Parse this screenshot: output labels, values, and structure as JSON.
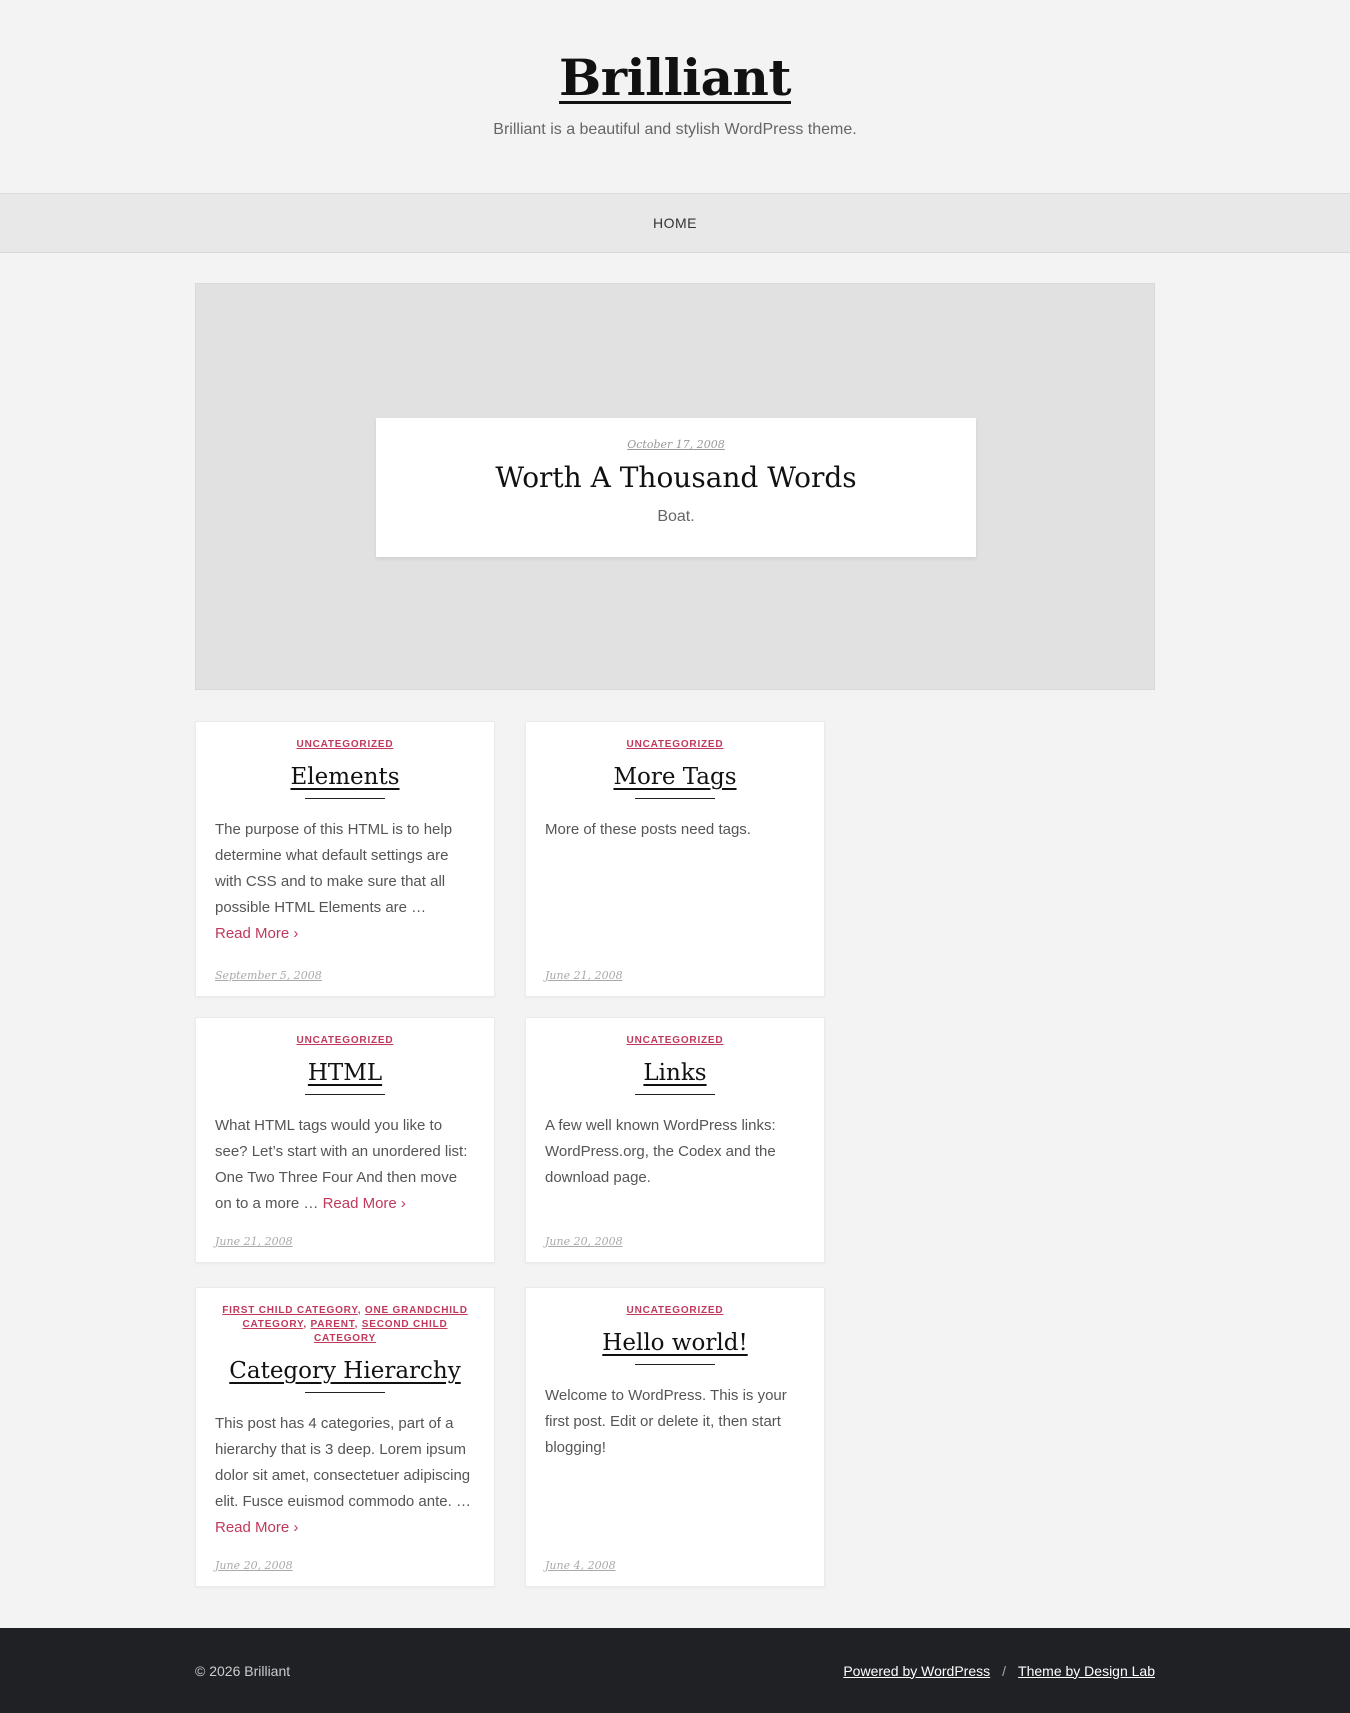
{
  "site": {
    "title": "Brilliant",
    "tagline": "Brilliant is a beautiful and stylish WordPress theme."
  },
  "nav": {
    "items": [
      {
        "label": "HOME"
      }
    ]
  },
  "featured": {
    "date": "October 17, 2008",
    "title": "Worth A Thousand Words",
    "excerpt": "Boat."
  },
  "posts": [
    {
      "categories": [
        "UNCATEGORIZED"
      ],
      "title": "Elements",
      "excerpt": "The purpose of this HTML is to help determine what default settings are with CSS and to make sure that all possible HTML Elements are …",
      "read_more": "Read More ›",
      "date": "September 5, 2008"
    },
    {
      "categories": [
        "UNCATEGORIZED"
      ],
      "title": "More Tags",
      "excerpt": "More of these posts need tags.",
      "read_more": "",
      "date": "June 21, 2008"
    },
    {
      "categories": [
        "UNCATEGORIZED"
      ],
      "title": "HTML",
      "excerpt": "What HTML tags would you like to see? Let’s start with an unordered list: One Two Three Four And then move on to a more …",
      "read_more": "Read More ›",
      "date": "June 21, 2008"
    },
    {
      "categories": [
        "UNCATEGORIZED"
      ],
      "title": "Links",
      "excerpt": "A few well known WordPress links: WordPress.org, the Codex and the download page.",
      "read_more": "",
      "date": "June 20, 2008"
    },
    {
      "categories": [
        "FIRST CHILD CATEGORY",
        "ONE GRANDCHILD CATEGORY",
        "PARENT",
        "SECOND CHILD CATEGORY"
      ],
      "title": "Category Hierarchy",
      "excerpt": "This post has 4 categories, part of a hierarchy that is 3 deep. Lorem ipsum dolor sit amet, consectetuer adipiscing elit. Fusce euismod commodo ante. …",
      "read_more": "Read More ›",
      "date": "June 20, 2008"
    },
    {
      "categories": [
        "UNCATEGORIZED"
      ],
      "title": "Hello world!",
      "excerpt": "Welcome to WordPress. This is your first post. Edit or delete it, then start blogging!",
      "read_more": "",
      "date": "June 4, 2008"
    }
  ],
  "footer": {
    "copyright": "© 2026 Brilliant",
    "links": [
      {
        "label": "Powered by WordPress"
      },
      {
        "label": "Theme by Design Lab"
      }
    ],
    "separator": "/"
  },
  "colors": {
    "accent": "#c0395d",
    "footer_bg": "#1f2125",
    "page_bg": "#f3f3f3"
  }
}
